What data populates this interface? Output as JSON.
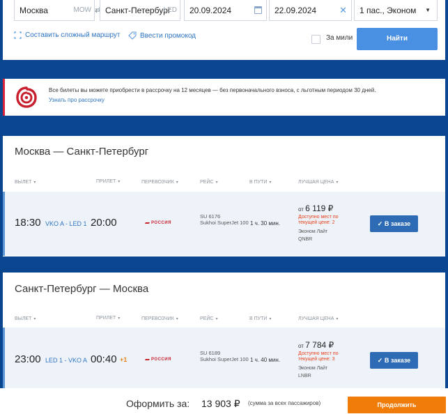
{
  "search": {
    "from_city": "Москва",
    "from_code": "MOW",
    "to_city": "Санкт-Петербург",
    "to_code": "LED",
    "date_there": "20.09.2024",
    "date_back": "22.09.2024",
    "passengers": "1 пас., Эконом",
    "complex_route": "Составить сложный маршрут",
    "promo_code": "Ввести промокод",
    "miles_label": "За мили",
    "find_button": "Найти"
  },
  "promo": {
    "text": "Все билеты вы можете приобрести в рассрочку на 12 месяцев — без первоначального взноса, с льготным периодом 30 дней.",
    "link": "Узнать про рассрочку"
  },
  "columns": {
    "depart": "Вылет",
    "arrive": "Прилет",
    "carrier": "Перевозчик",
    "flight": "Рейс",
    "duration": "В пути",
    "price": "Лучшая цена"
  },
  "legs": [
    {
      "title": "Москва — Санкт-Петербург",
      "depart_time": "18:30",
      "route": "VKO A - LED 1",
      "arrive_time": "20:00",
      "next_day": "",
      "carrier": "РОССИЯ",
      "flight_no": "SU 6176",
      "aircraft": "Sukhoi SuperJet 100",
      "duration": "1 ч. 30 мин.",
      "price_from": "от",
      "price": "6 119 ₽",
      "seats_note": "Доступно мест по текущей цене: 2",
      "fare": "Эконом Лайт",
      "fare_code": "QNBR",
      "book_label": "В заказе"
    },
    {
      "title": "Санкт-Петербург — Москва",
      "depart_time": "23:00",
      "route": "LED 1 - VKO A",
      "arrive_time": "00:40",
      "next_day": "+1",
      "carrier": "РОССИЯ",
      "flight_no": "SU 6189",
      "aircraft": "Sukhoi SuperJet 100",
      "duration": "1 ч. 40 мин.",
      "price_from": "от",
      "price": "7 784 ₽",
      "seats_note": "Доступно мест по текущей цене: 3",
      "fare": "Эконом Лайт",
      "fare_code": "LNBR",
      "book_label": "В заказе"
    }
  ],
  "footer": {
    "label": "Оформить за:",
    "total": "13 903 ₽",
    "note": "(сумма за всех пассажиров)",
    "continue": "Продолжить"
  },
  "colors": {
    "background": "#0a4690",
    "accent": "#2e6bb5",
    "find_button": "#4a90e2",
    "continue_button": "#f07c0a",
    "promo_brand": "#d8223a"
  }
}
